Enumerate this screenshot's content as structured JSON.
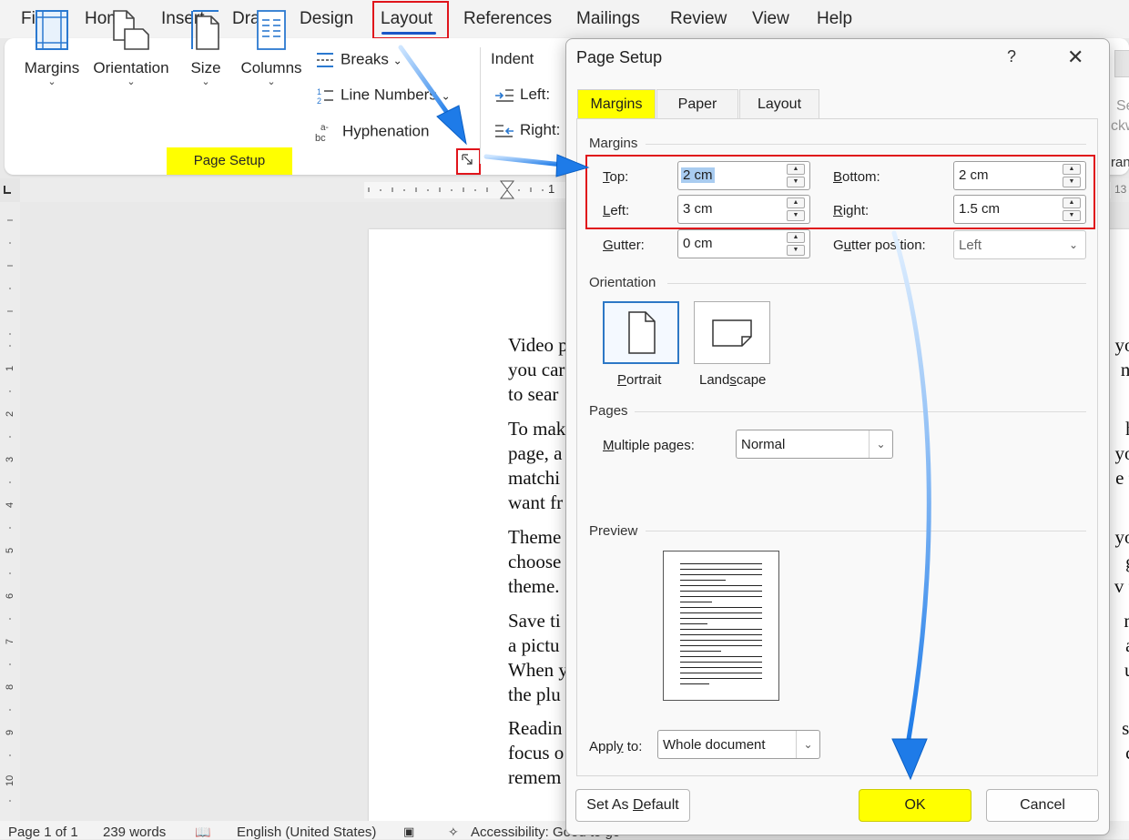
{
  "menu": {
    "items": [
      "File",
      "Home",
      "Insert",
      "Draw",
      "Design",
      "Layout",
      "References",
      "Mailings",
      "Review",
      "View",
      "Help"
    ],
    "active": "Layout"
  },
  "ribbon": {
    "margins": "Margins",
    "orientation": "Orientation",
    "size": "Size",
    "columns": "Columns",
    "breaks": "Breaks",
    "line_numbers": "Line Numbers",
    "hyphenation": "Hyphenation",
    "group_label": "Page Setup",
    "indent": "Indent",
    "indent_left": "Left:",
    "indent_right": "Right:",
    "partial_right_1": "Se",
    "partial_right_2": "ckw",
    "partial_right_3": "ran"
  },
  "ruler": {
    "mark": "1",
    "edge": "13"
  },
  "document": {
    "paragraphs": [
      [
        "Video p",
        "you car",
        "to sear"
      ],
      [
        "To mak",
        "page, a",
        "matchi",
        "want fr"
      ],
      [
        "Theme",
        "choose",
        "theme."
      ],
      [
        "Save ti",
        "a pictu",
        "When y",
        "the plu"
      ],
      [
        "Readin",
        "focus o",
        "remem"
      ]
    ],
    "right_fragments": [
      [
        "you",
        "n a"
      ],
      [
        "he",
        "you",
        "e th"
      ],
      [
        "you",
        "ge",
        "v th"
      ],
      [
        "m.",
        "ap",
        "un"
      ],
      [
        "s o",
        "ch"
      ]
    ]
  },
  "status": {
    "page": "Page 1 of 1",
    "words": "239 words",
    "language": "English (United States)",
    "accessibility": "Accessibility: Good to go"
  },
  "dialog": {
    "title": "Page Setup",
    "help": "?",
    "close": "✕",
    "tabs": [
      "Margins",
      "Paper",
      "Layout"
    ],
    "active_tab": "Margins",
    "margins_section": "Margins",
    "top_label": "Top:",
    "top_value": "2 cm",
    "bottom_label": "Bottom:",
    "bottom_value": "2 cm",
    "left_label": "Left:",
    "left_value": "3 cm",
    "right_label": "Right:",
    "right_value": "1.5 cm",
    "gutter_label": "Gutter:",
    "gutter_value": "0 cm",
    "gutter_pos_label": "Gutter position:",
    "gutter_pos_value": "Left",
    "orientation_section": "Orientation",
    "portrait": "Portrait",
    "landscape": "Landscape",
    "selected_orientation": "Portrait",
    "pages_section": "Pages",
    "multiple_pages_label": "Multiple pages:",
    "multiple_pages_value": "Normal",
    "preview_section": "Preview",
    "apply_to_label": "Apply to:",
    "apply_to_value": "Whole document",
    "set_default": "Set As Default",
    "ok": "OK",
    "cancel": "Cancel"
  },
  "colors": {
    "highlight": "#ffff00",
    "callout_red": "#e0141b",
    "arrow_blue": "#1e7be8",
    "accent": "#1a56c7"
  }
}
